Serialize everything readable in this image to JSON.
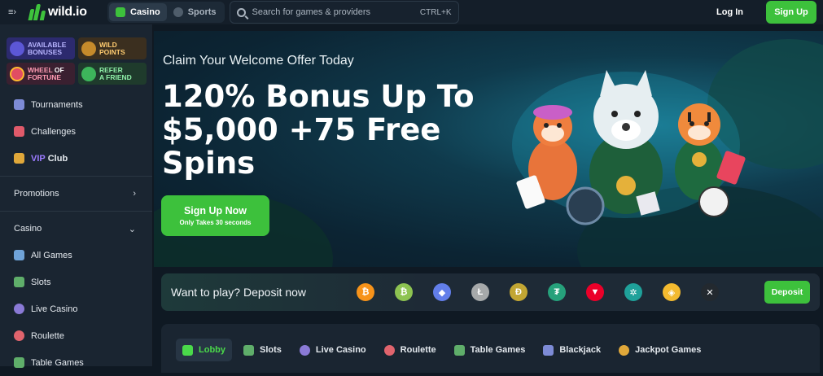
{
  "header": {
    "logo_text": "wild.io",
    "tabs": [
      {
        "label": "Casino",
        "active": true
      },
      {
        "label": "Sports",
        "active": false
      }
    ],
    "search": {
      "placeholder": "Search for games & providers",
      "shortcut": "CTRL+K"
    },
    "login_label": "Log In",
    "signup_label": "Sign Up"
  },
  "sidebar": {
    "promos": [
      {
        "line1": "AVAILABLE",
        "line2": "BONUSES"
      },
      {
        "line1": "WILD",
        "line2": "POINTS"
      },
      {
        "line1": "WHEEL",
        "line1b": "OF",
        "line2": "FORTUNE"
      },
      {
        "line1": "REFER",
        "line2": "A FRIEND"
      }
    ],
    "items": [
      {
        "label": "Tournaments"
      },
      {
        "label": "Challenges"
      }
    ],
    "vip": {
      "label_vip": "VIP",
      "label_club": "Club"
    },
    "promotions_label": "Promotions",
    "casino_label": "Casino",
    "casino_items": [
      {
        "label": "All Games"
      },
      {
        "label": "Slots"
      },
      {
        "label": "Live Casino"
      },
      {
        "label": "Roulette"
      },
      {
        "label": "Table Games"
      }
    ]
  },
  "hero": {
    "claim": "Claim Your Welcome Offer Today",
    "title": "120% Bonus Up To $5,000 +75 Free Spins",
    "cta_label": "Sign Up Now",
    "cta_sub": "Only Takes 30 seconds"
  },
  "deposit": {
    "text": "Want to play? Deposit now",
    "button_label": "Deposit",
    "coins": [
      {
        "name": "bitcoin-icon",
        "glyph": "₿",
        "color": "#f7931a"
      },
      {
        "name": "bitcoin-cash-icon",
        "glyph": "₿",
        "color": "#8dc351"
      },
      {
        "name": "ethereum-icon",
        "glyph": "◆",
        "color": "#627eea"
      },
      {
        "name": "litecoin-icon",
        "glyph": "Ł",
        "color": "#a6a9aa"
      },
      {
        "name": "dogecoin-icon",
        "glyph": "Ð",
        "color": "#c2a633"
      },
      {
        "name": "tether-icon",
        "glyph": "₮",
        "color": "#26a17b"
      },
      {
        "name": "tron-icon",
        "glyph": "▼",
        "color": "#eb0029"
      },
      {
        "name": "cardano-icon",
        "glyph": "✲",
        "color": "#1fa19a"
      },
      {
        "name": "bnb-icon",
        "glyph": "◈",
        "color": "#f3ba2f"
      },
      {
        "name": "xrp-icon",
        "glyph": "✕",
        "color": "#23292f"
      }
    ]
  },
  "lobby": {
    "tabs": [
      {
        "label": "Lobby",
        "active": true
      },
      {
        "label": "Slots"
      },
      {
        "label": "Live Casino"
      },
      {
        "label": "Roulette"
      },
      {
        "label": "Table Games"
      },
      {
        "label": "Blackjack"
      },
      {
        "label": "Jackpot Games"
      }
    ]
  }
}
